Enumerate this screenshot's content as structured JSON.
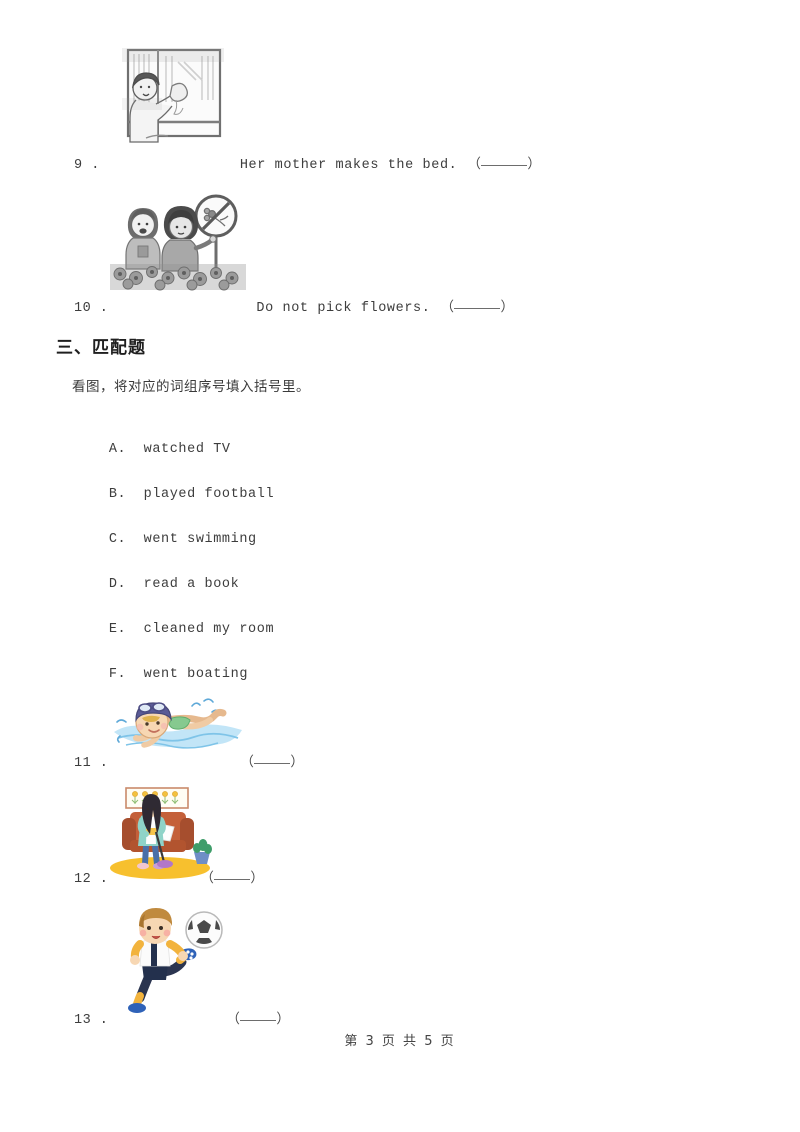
{
  "document": {
    "type": "exam-worksheet",
    "language": "zh-CN/en"
  },
  "items_top": [
    {
      "number": "9 .",
      "sentence": "Her mother makes the bed.",
      "blank_open": "（",
      "blank_close": "）",
      "image_alt": "woman-cleaning-window-sketch"
    },
    {
      "number": "10 .",
      "sentence": "Do not pick flowers.",
      "blank_open": "（",
      "blank_close": "）",
      "image_alt": "two-children-no-picking-flowers-sign-sketch"
    }
  ],
  "section": {
    "heading": "三、匹配题",
    "instruction": "看图，将对应的词组序号填入括号里。"
  },
  "options": [
    {
      "letter": "A.",
      "text": "watched TV"
    },
    {
      "letter": "B.",
      "text": "played football"
    },
    {
      "letter": "C.",
      "text": "went swimming"
    },
    {
      "letter": "D.",
      "text": "read a book"
    },
    {
      "letter": "E.",
      "text": "cleaned my room"
    },
    {
      "letter": "F.",
      "text": "went boating"
    }
  ],
  "match_items": [
    {
      "number": "11 .",
      "blank_open": "（",
      "blank_close": "）",
      "image_alt": "boy-swimming-color-illustration"
    },
    {
      "number": "12 .",
      "blank_open": "（",
      "blank_close": "）",
      "image_alt": "girl-cleaning-room-color-illustration"
    },
    {
      "number": "13 .",
      "blank_open": "（",
      "blank_close": "）",
      "image_alt": "boy-playing-football-color-illustration"
    }
  ],
  "footer": {
    "text": "第 3 页 共 5 页"
  },
  "colors": {
    "text": "#3d3d3d",
    "heading": "#1f1f1f",
    "water": "#b9e3f6",
    "cap": "#4a4a8a",
    "sofa": "#c4603a",
    "rug": "#f6c12e",
    "skin": "#f6d2b5",
    "shirt_dark": "#2b3550",
    "shirt_yellow": "#f2b33d"
  }
}
